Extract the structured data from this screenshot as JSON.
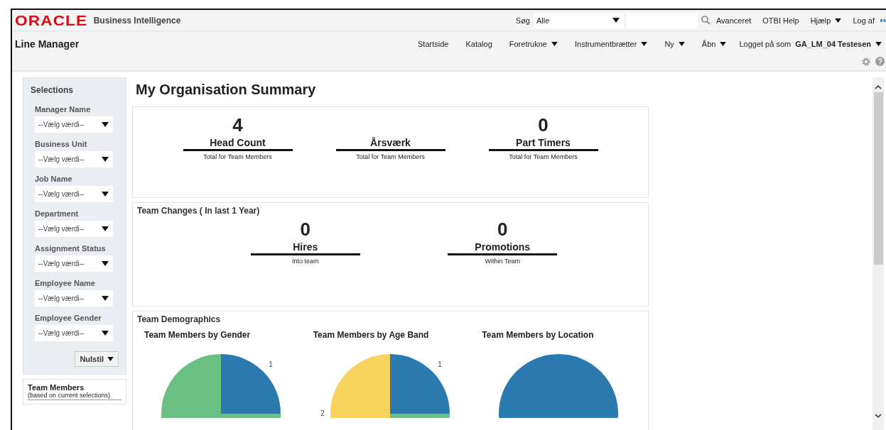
{
  "header": {
    "logo": "ORACLE",
    "product": "Business Intelligence",
    "search": {
      "label": "Søg",
      "scope": "Alle"
    },
    "links": [
      {
        "label": "Avanceret",
        "menu": false
      },
      {
        "label": "OTBI Help",
        "menu": false
      },
      {
        "label": "Hjælp",
        "menu": true
      },
      {
        "label": "Log af",
        "menu": false
      }
    ]
  },
  "nav": {
    "title": "Line Manager",
    "items": [
      {
        "label": "Startside",
        "menu": false
      },
      {
        "label": "Katalog",
        "menu": false
      },
      {
        "label": "Foretrukne",
        "menu": true
      },
      {
        "label": "Instrumentbrætter",
        "menu": true
      },
      {
        "label": "Ny",
        "menu": true
      },
      {
        "label": "Åbn",
        "menu": true
      }
    ],
    "user": {
      "prefix": "Logget på som",
      "name": "GA_LM_04 Testesen"
    }
  },
  "selections": {
    "title": "Selections",
    "filters": [
      {
        "label": "Manager Name",
        "value": "--Vælg værdi--"
      },
      {
        "label": "Business Unit",
        "value": "--Vælg værdi--"
      },
      {
        "label": "Job Name",
        "value": "--Vælg værdi--"
      },
      {
        "label": "Department",
        "value": "--Vælg værdi--"
      },
      {
        "label": "Assignment Status",
        "value": "--Vælg værdi--"
      },
      {
        "label": "Employee Name",
        "value": "--Vælg værdi--"
      },
      {
        "label": "Employee Gender",
        "value": "--Vælg værdi--"
      }
    ],
    "reset": "Nulstil"
  },
  "team_members": {
    "title": "Team Members",
    "note": "(based on current selections)"
  },
  "page_title": "My Organisation Summary",
  "summary": {
    "metrics": [
      {
        "value": "4",
        "label": "Head Count",
        "caption": "Total for Team Members"
      },
      {
        "label": "Årsværk",
        "caption": "Total for Team Members"
      },
      {
        "value": "0",
        "label": "Part Timers",
        "caption": "Total for Team Members"
      }
    ]
  },
  "team_changes": {
    "title": "Team Changes ( In last 1 Year)",
    "metrics": [
      {
        "value": "0",
        "label": "Hires",
        "caption": "Into team"
      },
      {
        "value": "0",
        "label": "Promotions",
        "caption": "Within Team"
      }
    ]
  },
  "demographics": {
    "title": "Team Demographics",
    "charts": [
      {
        "title": "Team Members by Gender",
        "chart_data": {
          "type": "pie",
          "values": [
            1,
            3
          ],
          "value_labels": [
            "1",
            null
          ]
        }
      },
      {
        "title": "Team Members by Age Band",
        "chart_data": {
          "type": "pie",
          "values": [
            1,
            1,
            2
          ],
          "value_labels": [
            "1",
            null,
            "2"
          ]
        }
      },
      {
        "title": "Team Members by Location",
        "chart_data": {
          "type": "pie",
          "values": [
            100
          ],
          "value_labels": [
            null
          ]
        }
      }
    ]
  }
}
